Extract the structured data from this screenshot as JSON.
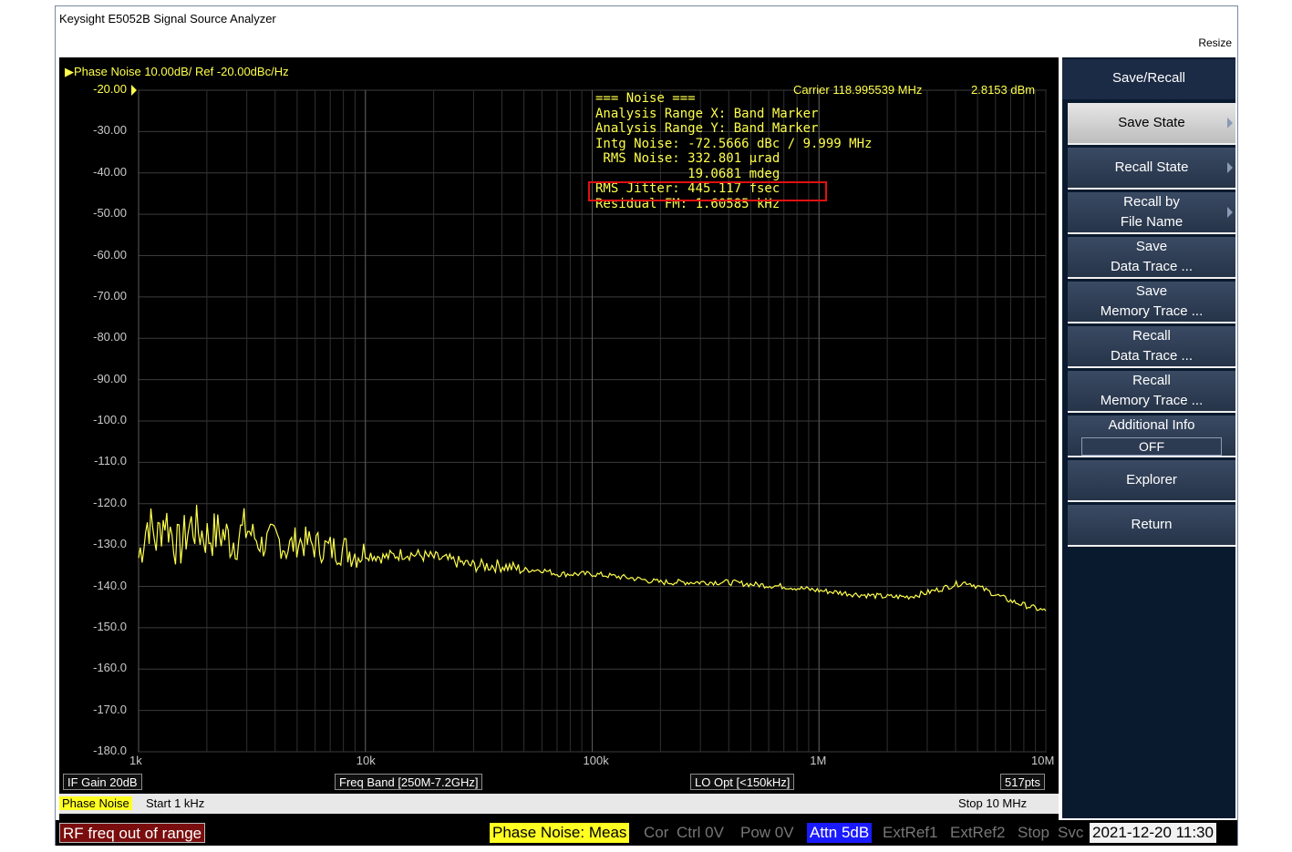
{
  "window": {
    "title": "Keysight E5052B Signal Source Analyzer",
    "resize_label": "Resize"
  },
  "chart": {
    "header": "Phase Noise 10.00dB/ Ref -20.00dBc/Hz",
    "carrier": "Carrier 118.995539 MHz",
    "carrier_power": "2.8153 dBm",
    "noise_panel": [
      "=== Noise ===",
      "Analysis Range X: Band Marker",
      "Analysis Range Y: Band Marker",
      "Intg Noise: -72.5666 dBc / 9.999 MHz",
      " RMS Noise: 332.801 µrad",
      "            19.0681 mdeg",
      "RMS Jitter: 445.117 fsec",
      "Residual FM: 1.60585 kHz"
    ],
    "trace_color": "#ffff4c"
  },
  "chart_data": {
    "type": "line",
    "title": "Phase Noise 10.00dB/ Ref -20.00dBc/Hz",
    "x_scale": "log",
    "xlim": [
      1000,
      10000000
    ],
    "ylim": [
      -180,
      -20
    ],
    "grid": true,
    "y_tick_labels": [
      "-20.00",
      "-30.00",
      "-40.00",
      "-50.00",
      "-60.00",
      "-70.00",
      "-80.00",
      "-90.00",
      "-100.0",
      "-110.0",
      "-120.0",
      "-130.0",
      "-140.0",
      "-150.0",
      "-160.0",
      "-170.0",
      "-180.0"
    ],
    "x_tick_labels": [
      "1k",
      "10k",
      "100k",
      "1M",
      "10M"
    ],
    "x_ticks": [
      1000,
      10000,
      100000,
      1000000,
      10000000
    ],
    "series": [
      {
        "points_x": [
          1000,
          1100,
          1200,
          1300,
          1500,
          1700,
          2000,
          2300,
          2600,
          3000,
          3500,
          4000,
          4500,
          5000,
          6000,
          7000,
          8000,
          9000,
          10000,
          12000,
          15000,
          20000,
          25000,
          30000,
          40000,
          50000,
          60000,
          70000,
          80000,
          100000,
          150000,
          200000,
          300000,
          400000,
          500000,
          700000,
          1000000,
          1500000,
          2000000,
          2500000,
          3000000,
          3500000,
          4000000,
          4500000,
          5000000,
          6000000,
          7000000,
          8000000,
          10000000
        ],
        "points_y": [
          -133,
          -124,
          -129,
          -123,
          -131,
          -125,
          -128,
          -127,
          -129,
          -126,
          -130,
          -128,
          -131,
          -129,
          -130,
          -131,
          -131,
          -132,
          -132,
          -133,
          -132,
          -133,
          -134,
          -135,
          -135,
          -136,
          -136,
          -137,
          -137,
          -137,
          -138,
          -139,
          -139,
          -139,
          -139.5,
          -140,
          -141,
          -142,
          -142.5,
          -142.5,
          -141.5,
          -140.5,
          -139.5,
          -139,
          -140,
          -142,
          -143.5,
          -144.5,
          -146
        ]
      }
    ]
  },
  "statusbar_top": {
    "if_gain": "IF Gain 20dB",
    "freq_band": "Freq Band [250M-7.2GHz]",
    "lo_opt": "LO Opt [<150kHz]",
    "points": "517pts"
  },
  "statusbar_meas": {
    "meas_label": "Phase Noise",
    "start": "Start 1 kHz",
    "stop": "Stop 10 MHz"
  },
  "statusbar_bottom": {
    "message": "RF freq out of range",
    "meas": "Phase Noise: Meas",
    "cor": "Cor",
    "ctrl": "Ctrl  0V",
    "pow": "Pow  0V",
    "attn": "Attn 5dB",
    "extref1": "ExtRef1",
    "extref2": "ExtRef2",
    "stop": "Stop",
    "svc": "Svc",
    "datetime": "2021-12-20 11:30"
  },
  "softkeys": {
    "title": "Save/Recall",
    "save_state": "Save State",
    "recall_state": "Recall State",
    "recall_by_1": "Recall by",
    "recall_by_2": "File Name",
    "save_data_1": "Save",
    "save_data_2": "Data Trace ...",
    "save_mem_1": "Save",
    "save_mem_2": "Memory Trace ...",
    "recall_data_1": "Recall",
    "recall_data_2": "Data Trace ...",
    "recall_mem_1": "Recall",
    "recall_mem_2": "Memory Trace ...",
    "addl_info": "Additional Info",
    "addl_info_value": "OFF",
    "explorer": "Explorer",
    "return": "Return"
  }
}
